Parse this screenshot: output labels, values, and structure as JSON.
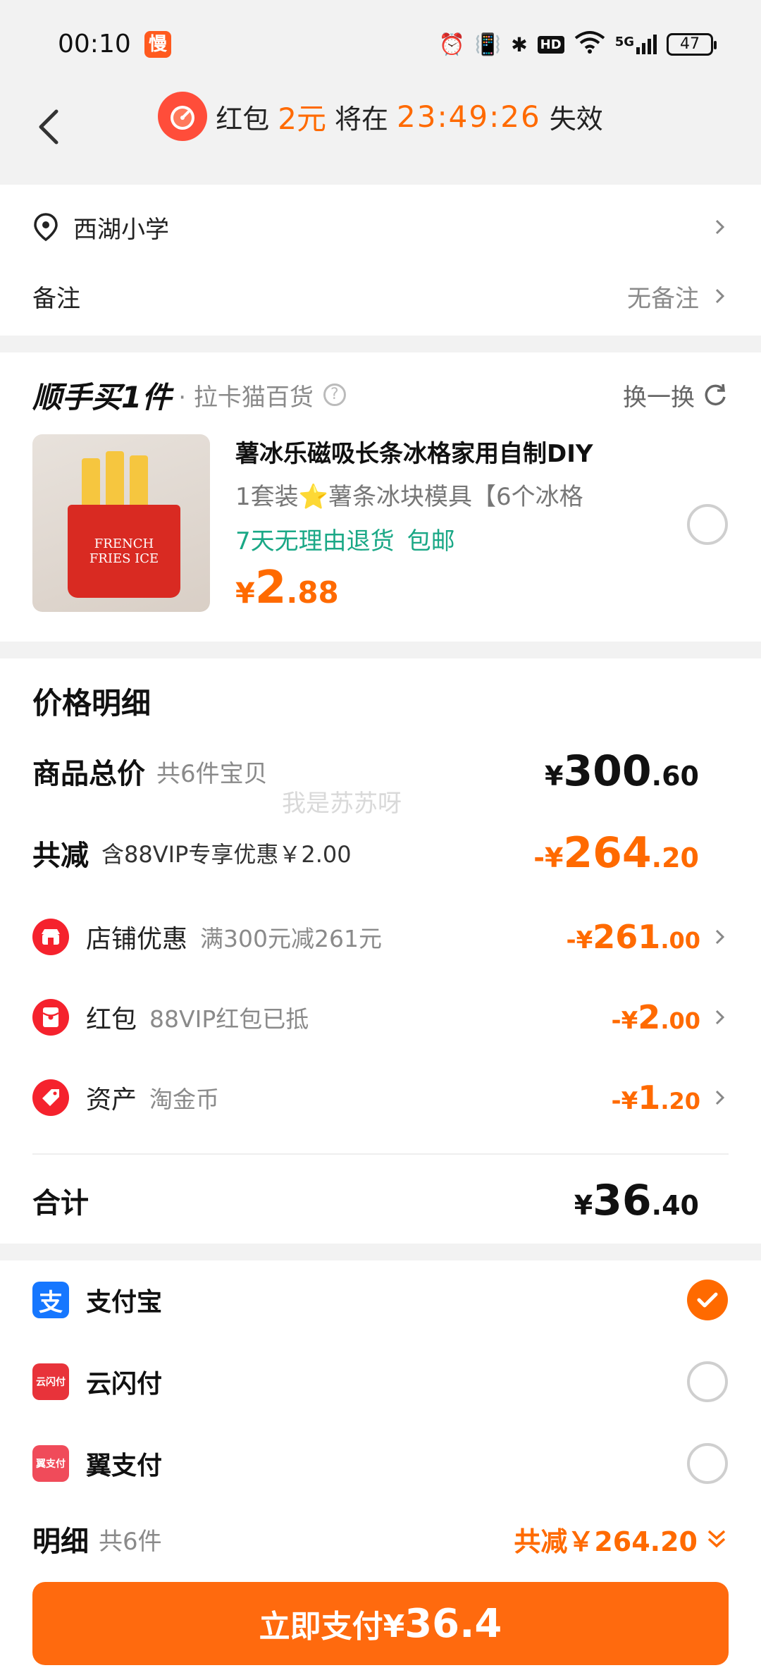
{
  "status": {
    "time": "00:10",
    "app_badge": "慢",
    "hd": "HD",
    "net": "5G",
    "battery": "47"
  },
  "header": {
    "prefix": "红包",
    "amount": "2元",
    "middle": "将在",
    "countdown": "23:49:26",
    "suffix": "失效"
  },
  "address": {
    "name": "西湖小学"
  },
  "remark": {
    "label": "备注",
    "value": "无备注"
  },
  "upsell": {
    "brand_title": "顺手买1件",
    "store": "· 拉卡猫百货",
    "refresh_label": "换一换",
    "product": {
      "title": "薯冰乐磁吸长条冰格家用自制DIY",
      "subtitle": "1套装⭐薯条冰块模具【6个冰格",
      "tag_return": "7天无理由退货",
      "tag_shipping": "包邮",
      "price_symbol": "¥",
      "price_int": "2",
      "price_dec": ".88",
      "image_text": "FRENCH FRIES ICE"
    }
  },
  "price_detail": {
    "title": "价格明细",
    "total": {
      "label": "商品总价",
      "note": "共6件宝贝",
      "symbol": "¥",
      "int": "300",
      "dec": ".60"
    },
    "reduce": {
      "label": "共减",
      "note": "含88VIP专享优惠￥2.00",
      "prefix": "-¥",
      "int": "264",
      "dec": ".20"
    },
    "items": [
      {
        "label": "店铺优惠",
        "note": "满300元减261元",
        "prefix": "-¥",
        "int": "261",
        "dec": ".00"
      },
      {
        "label": "红包",
        "note": "88VIP红包已抵",
        "prefix": "-¥",
        "int": "2",
        "dec": ".00"
      },
      {
        "label": "资产",
        "note": "淘金币",
        "prefix": "-¥",
        "int": "1",
        "dec": ".20"
      }
    ],
    "sum": {
      "label": "合计",
      "symbol": "¥",
      "int": "36",
      "dec": ".40"
    },
    "watermark": "我是苏苏呀"
  },
  "payment": {
    "methods": [
      {
        "label": "支付宝",
        "selected": true
      },
      {
        "label": "云闪付",
        "selected": false
      },
      {
        "label": "翼支付",
        "selected": false
      }
    ],
    "unionpay_icon_text": "云闪付",
    "yi_icon_text": "翼支付"
  },
  "footer": {
    "detail_label": "明细",
    "detail_count": "共6件",
    "discount_text": "共减￥264.20",
    "button_label": "立即支付¥",
    "button_amount": "36.4"
  },
  "colors": {
    "accent": "#ff6a00",
    "green": "#1aa886",
    "alipay": "#1677ff",
    "red": "#f5222d"
  }
}
